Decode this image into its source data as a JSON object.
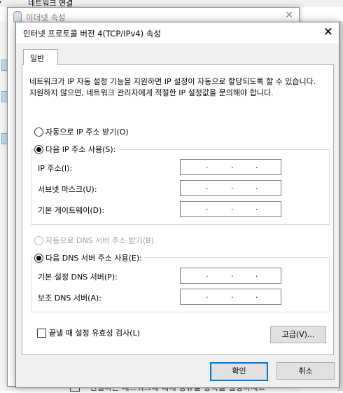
{
  "background": {
    "top_title": "네트워크 연결",
    "back_window_title": "이더넷 속성",
    "bottom_text": "연결하는 네트워크에 대해 공유할 항목을 설정하세요"
  },
  "dialog": {
    "title": "인터넷 프로토콜 버전 4(TCP/IPv4) 속성",
    "close": "✕",
    "tab_general": "일반",
    "description": "네트워크가 IP 자동 설정 기능을 지원하면 IP 설정이 자동으로 할당되도록 할 수 있습니다. 지원하지 않으면, 네트워크 관리자에게 적절한 IP 설정값을 문의해야 합니다.",
    "ip": {
      "auto_label": "자동으로 IP 주소 받기(O)",
      "auto_selected": false,
      "manual_label": "다음 IP 주소 사용(S):",
      "manual_selected": true,
      "fields": [
        {
          "label": "IP 주소(I):",
          "value": "   .   .   ."
        },
        {
          "label": "서브넷 마스크(U):",
          "value": "   .   .   ."
        },
        {
          "label": "기본 게이트웨이(D):",
          "value": "   .   .   ."
        }
      ]
    },
    "dns": {
      "auto_label": "자동으로 DNS 서버 주소 받기(B)",
      "auto_disabled": true,
      "manual_label": "다음 DNS 서버 주소 사용(E):",
      "manual_selected": true,
      "fields": [
        {
          "label": "기본 설정 DNS 서버(P):",
          "value": "   .   .   ."
        },
        {
          "label": "보조 DNS 서버(A):",
          "value": "   .   .   ."
        }
      ]
    },
    "validate_label": "끝낼 때 설정 유효성 검사(L)",
    "validate_checked": false,
    "advanced_button": "고급(V)...",
    "ok_button": "확인",
    "cancel_button": "취소"
  },
  "colors": {
    "dialog_bg": "#f0f0f0",
    "panel_bg": "#ffffff",
    "primary_border": "#0078d7",
    "disabled_text": "#a0a0a0"
  }
}
